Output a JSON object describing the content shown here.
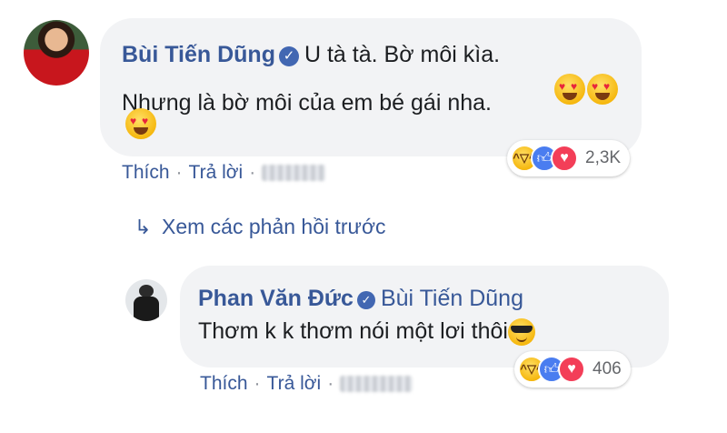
{
  "comment1": {
    "author": "Bùi Tiến Dũng",
    "line1": "U tà tà. Bờ môi kìa.",
    "line2": "Nhưng là bờ môi của em bé gái nha.",
    "emoji_name": "heart-eyes-emoji",
    "reaction_icons": [
      "haha-icon",
      "like-icon",
      "love-icon"
    ],
    "reaction_count": "2,3K",
    "like_label": "Thích",
    "reply_label": "Trả lời",
    "separator": "·"
  },
  "view_previous_replies": {
    "icon": "reply-arrow-icon",
    "label": "Xem các phản hồi trước"
  },
  "comment2": {
    "author": "Phan Văn Đức",
    "tagged_user": "Bùi Tiến Dũng",
    "text": "Thơm k k thơm nói một lơi thôi",
    "emoji_name": "sunglasses-emoji",
    "reaction_icons": [
      "haha-icon",
      "like-icon",
      "love-icon"
    ],
    "reaction_count": "406",
    "like_label": "Thích",
    "reply_label": "Trả lời",
    "separator": "·"
  },
  "colors": {
    "link_blue": "#385898",
    "bubble_bg": "#f2f3f5",
    "verified_blue": "#4267b2",
    "love_red": "#f33e58",
    "like_blue": "#4a7df0"
  }
}
